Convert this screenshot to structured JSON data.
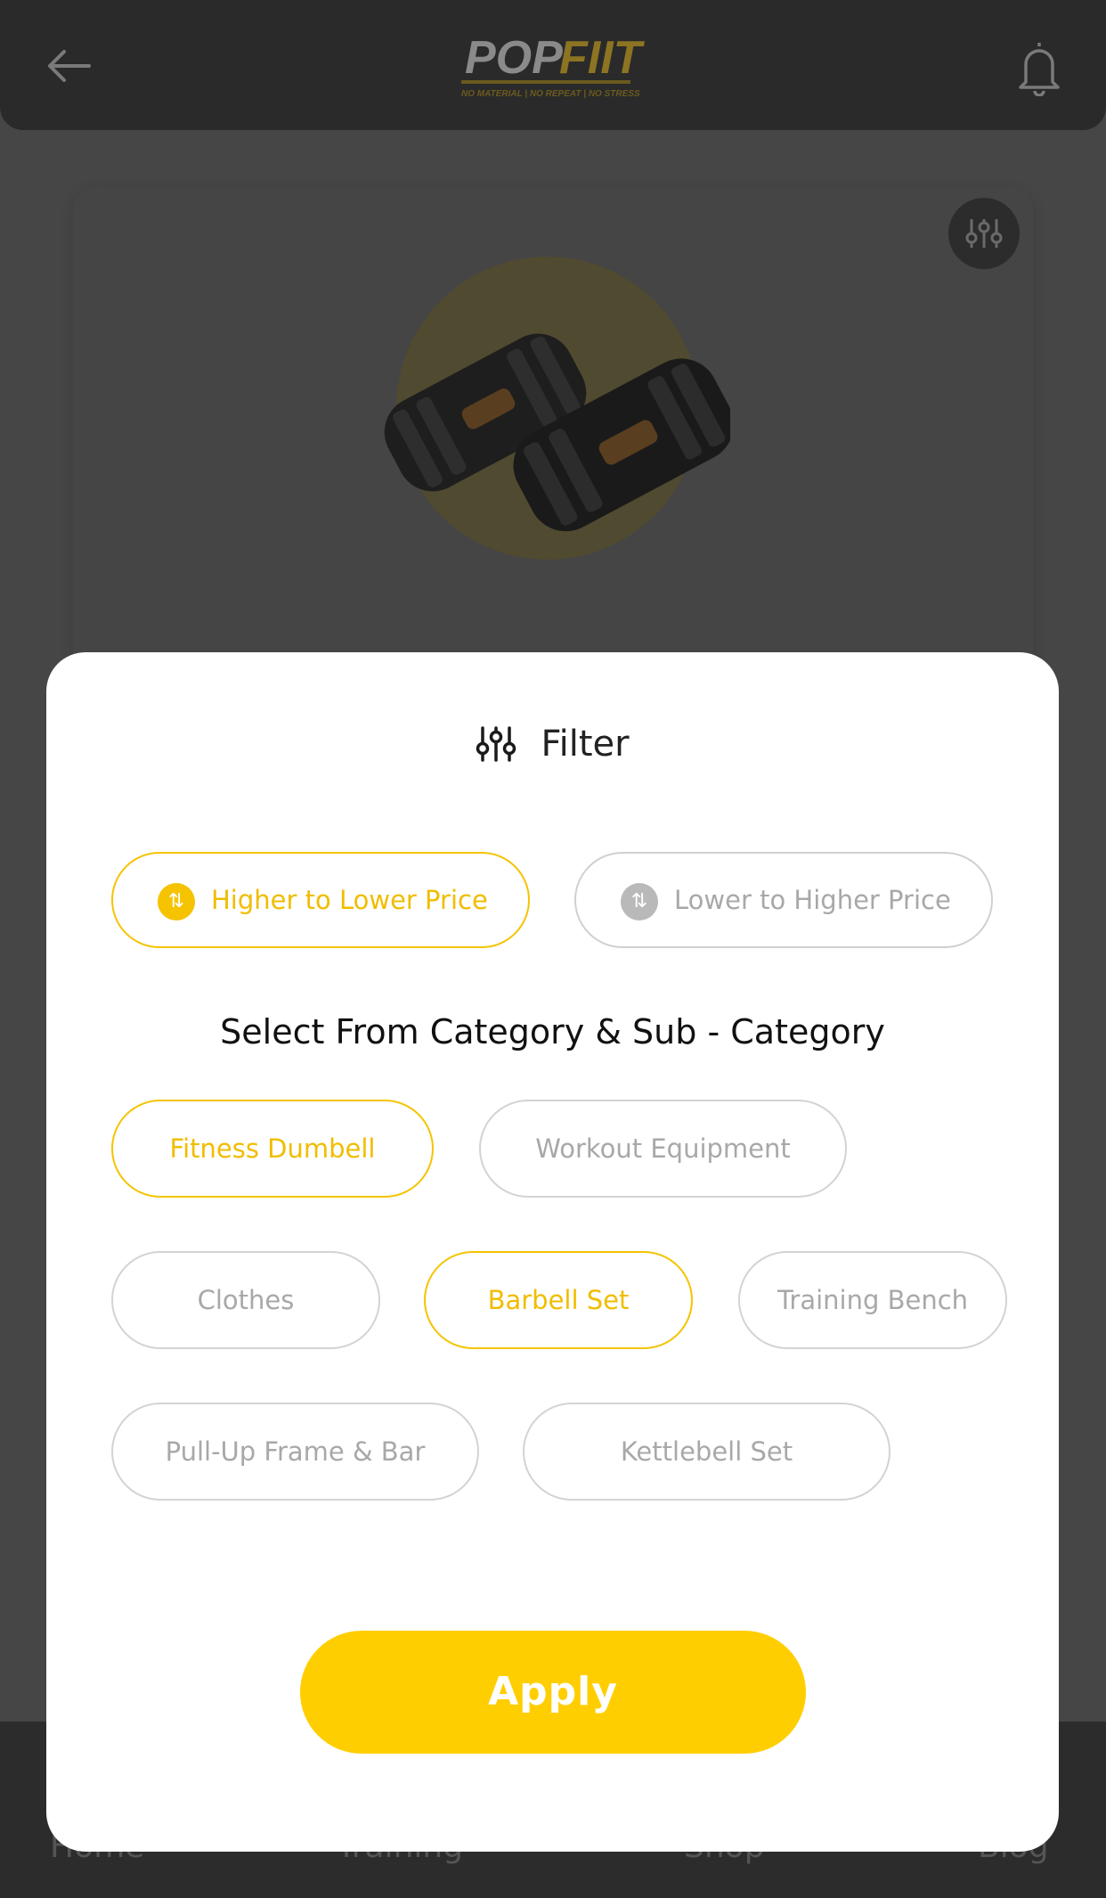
{
  "header": {
    "logo_text": "POP FIIT",
    "logo_tagline": "NO MATERIAL | NO REPEAT | NO STRESS",
    "back_icon": "arrow-left-icon",
    "notification_icon": "bell-icon"
  },
  "bottom_nav": {
    "items": [
      {
        "label": "Home"
      },
      {
        "label": "Training"
      },
      {
        "label": "Shop"
      },
      {
        "label": "Blog"
      }
    ]
  },
  "filter_modal": {
    "title": "Filter",
    "title_icon": "sliders-icon",
    "sort_options": [
      {
        "label": "Higher to Lower Price",
        "icon": "sort-arrows-icon",
        "selected": true
      },
      {
        "label": "Lower to Higher Price",
        "icon": "sort-arrows-icon",
        "selected": false
      }
    ],
    "category_heading": "Select From Category & Sub - Category",
    "categories": [
      {
        "label": "Fitness Dumbell",
        "selected": true
      },
      {
        "label": "Workout Equipment",
        "selected": false
      },
      {
        "label": "Clothes",
        "selected": false
      },
      {
        "label": "Barbell Set",
        "selected": true
      },
      {
        "label": "Training Bench",
        "selected": false
      },
      {
        "label": "Pull-Up Frame & Bar",
        "selected": false
      },
      {
        "label": "Kettlebell Set",
        "selected": false
      }
    ],
    "apply_label": "Apply"
  },
  "colors": {
    "accent": "#ffce00",
    "accent_text": "#f0bd00",
    "inactive_text": "#a8a8a8",
    "overlay": "#464646",
    "header_bg": "#2a2a2a"
  }
}
